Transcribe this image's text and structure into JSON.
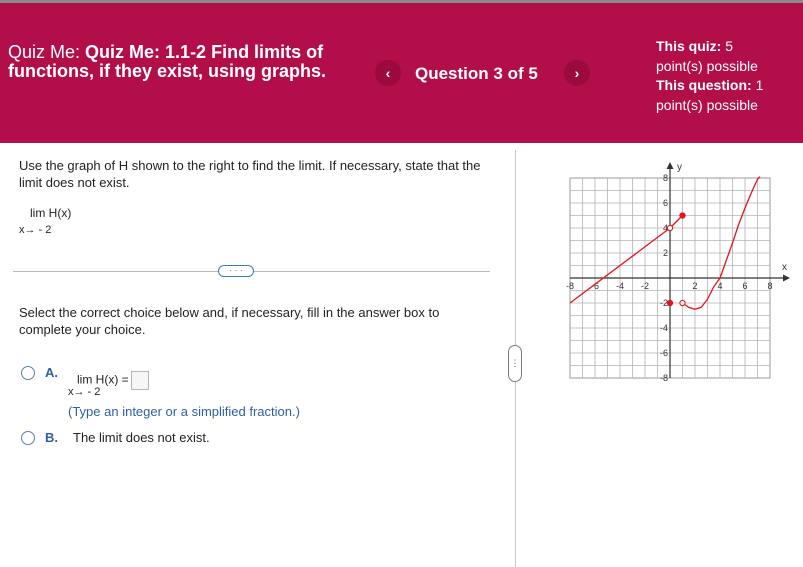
{
  "header": {
    "quiz_prefix": "Quiz Me:",
    "quiz_name": "Quiz Me: 1.1-2 Find limits of functions, if they exist, using graphs.",
    "question_count": "Question 3 of 5",
    "prev_icon": "chevron-left-icon",
    "next_icon": "chevron-right-icon",
    "prev_glyph": "‹",
    "next_glyph": "›",
    "quiz_points_label": "This quiz:",
    "quiz_points_value": "5",
    "quiz_points_suffix": "point(s) possible",
    "question_points_label": "This question:",
    "question_points_value": "1",
    "question_points_suffix": "point(s) possible"
  },
  "question": {
    "instruction": "Use the graph of H shown to the right to find the limit. If necessary, state that the limit does not exist.",
    "limit": "lim  H(x)",
    "limit_sub": "x→ - 2",
    "expander": "· · ·",
    "select_instruction": "Select the correct choice below and, if necessary, fill in the answer box to complete your choice."
  },
  "choices": {
    "a": {
      "letter": "A.",
      "limit": "lim  H(x) =",
      "limit_sub": "x→ - 2",
      "answer_value": "",
      "hint": "(Type an integer or a simplified fraction.)"
    },
    "b": {
      "letter": "B.",
      "text": "The limit does not exist."
    }
  },
  "side_handle": "⋮",
  "colors": {
    "header_bg": "#b20e4a",
    "accent_blue": "#2f5fa5",
    "curve_red": "#e3141b"
  },
  "chart_data": {
    "type": "line",
    "xlabel": "x",
    "ylabel": "y",
    "xlim": [
      -8,
      8
    ],
    "ylim": [
      -8,
      8
    ],
    "grid": true,
    "x_ticks": [
      "-8",
      "-6",
      "-4",
      "-2",
      "2",
      "4",
      "6",
      "8"
    ],
    "y_ticks": [
      "8",
      "6",
      "4",
      "2",
      "-2",
      "-4",
      "-6",
      "-8"
    ],
    "series": [
      {
        "kind": "line",
        "x": [
          -8,
          0
        ],
        "y": [
          -2,
          4
        ]
      },
      {
        "kind": "line",
        "x": [
          0,
          1
        ],
        "y": [
          4,
          5
        ]
      },
      {
        "kind": "curve",
        "x": [
          1,
          1.5,
          2,
          2.5,
          3,
          3.5,
          4,
          4.5,
          5,
          5.5,
          6,
          6.5,
          7,
          7.2
        ],
        "y": [
          -2,
          -2.35,
          -2.5,
          -2.35,
          -1.7,
          -0.7,
          0,
          1.4,
          2.8,
          4.3,
          5.6,
          6.8,
          7.9,
          8.1
        ]
      }
    ],
    "points": [
      {
        "x": 0,
        "y": 4,
        "filled": false
      },
      {
        "x": 1,
        "y": 5,
        "filled": true
      },
      {
        "x": 0,
        "y": -2,
        "filled": true
      },
      {
        "x": 1,
        "y": -2,
        "filled": false
      }
    ]
  }
}
